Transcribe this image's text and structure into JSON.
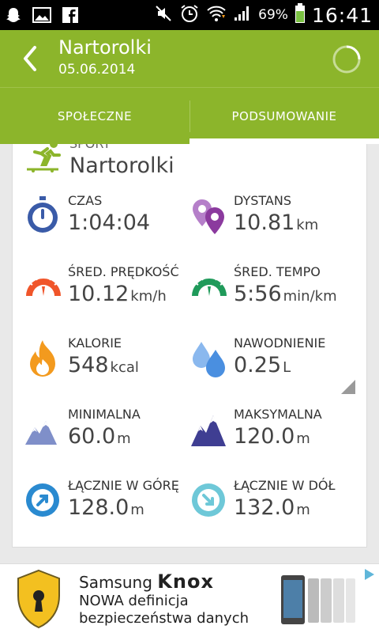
{
  "statusbar": {
    "battery": "69%",
    "time": "16:41"
  },
  "header": {
    "title": "Nartorolki",
    "date": "05.06.2014",
    "back_icon": "back-arrow-icon",
    "progress_icon": "loading-spinner-icon"
  },
  "tabs": [
    {
      "label": "SPOŁECZNE",
      "active": false
    },
    {
      "label": "PODSUMOWANIE",
      "active": true
    }
  ],
  "activity": {
    "cut_label": "SPORT",
    "name": "Nartorolki",
    "icon": "roller-ski-icon"
  },
  "stats": [
    {
      "label": "CZAS",
      "value": "1:04:04",
      "unit": "",
      "icon": "stopwatch-icon"
    },
    {
      "label": "DYSTANS",
      "value": "10.81",
      "unit": "km",
      "icon": "location-pins-icon"
    },
    {
      "label": "ŚRED. PRĘDKOŚĆ",
      "value": "10.12",
      "unit": "km/h",
      "icon": "speedometer-icon"
    },
    {
      "label": "ŚRED. TEMPO",
      "value": "5:56",
      "unit": "min/km",
      "icon": "pace-gauge-icon"
    },
    {
      "label": "KALORIE",
      "value": "548",
      "unit": "kcal",
      "icon": "flame-icon"
    },
    {
      "label": "NAWODNIENIE",
      "value": "0.25",
      "unit": "L",
      "icon": "water-drops-icon"
    },
    {
      "label": "MINIMALNA",
      "value": "60.0",
      "unit": "m",
      "icon": "mountain-low-icon"
    },
    {
      "label": "MAKSYMALNA",
      "value": "120.0",
      "unit": "m",
      "icon": "mountain-high-icon"
    },
    {
      "label": "ŁĄCZNIE W GÓRĘ",
      "value": "128.0",
      "unit": "m",
      "icon": "ascent-arrow-icon"
    },
    {
      "label": "ŁĄCZNIE W DÓŁ",
      "value": "132.0",
      "unit": "m",
      "icon": "descent-arrow-icon"
    }
  ],
  "ad": {
    "brand_prefix": "Samsung",
    "brand": "Knox",
    "line1": "NOWA definicja",
    "line2": "bezpieczeństwa danych"
  },
  "colors": {
    "accent": "#8cb52b",
    "blue": "#3a5ba8",
    "purple": "#8b3a9e",
    "orange": "#f0552a",
    "green": "#1f9a5a",
    "fire": "#f39a1e",
    "water": "#4a8fe0",
    "mountain_light": "#7f8fc9",
    "mountain_dark": "#3f3e92",
    "ascent": "#2a8ad0",
    "descent": "#6ec8d8"
  }
}
